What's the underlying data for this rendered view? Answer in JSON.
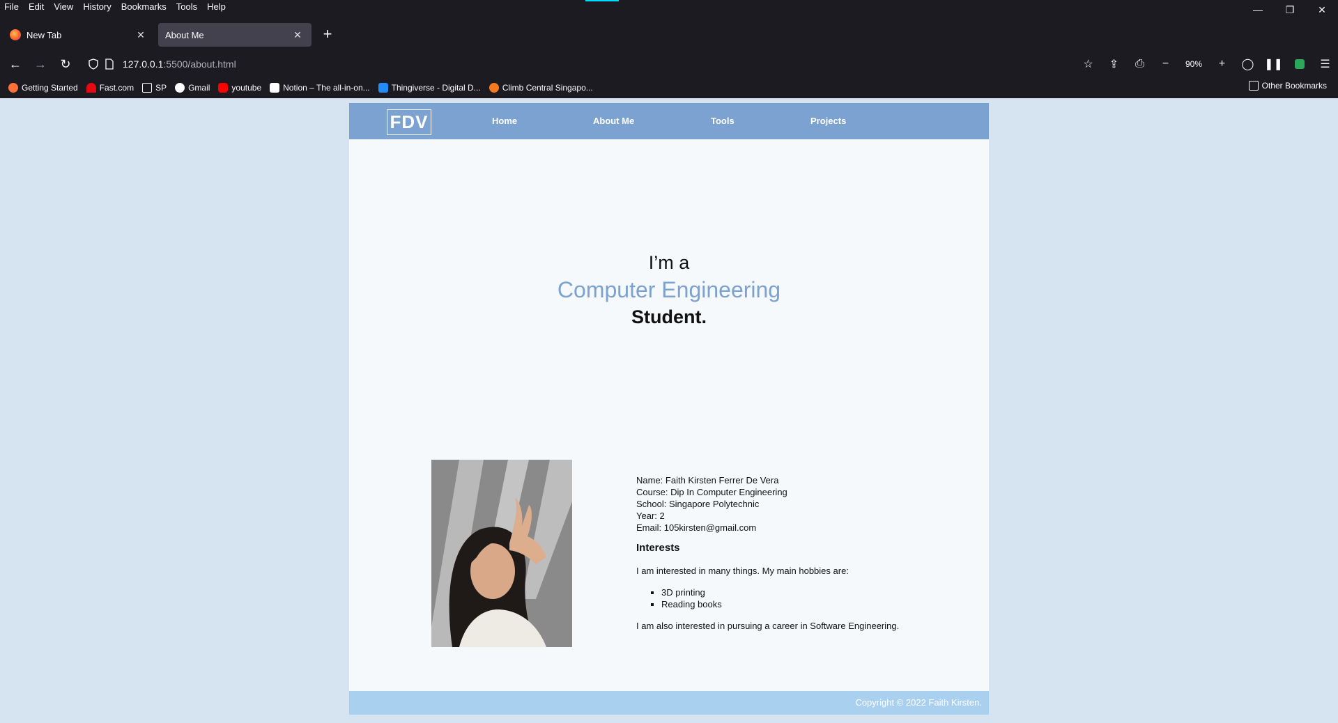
{
  "menubar": [
    "File",
    "Edit",
    "View",
    "History",
    "Bookmarks",
    "Tools",
    "Help"
  ],
  "tabs": [
    {
      "title": "New Tab",
      "active": false
    },
    {
      "title": "About Me",
      "active": true
    }
  ],
  "address": {
    "host": "127.0.0.1",
    "path": ":5500/about.html"
  },
  "zoom": "90%",
  "bookmarks": [
    {
      "label": "Getting Started",
      "color": "#ff7139"
    },
    {
      "label": "Fast.com",
      "color": "#e50914"
    },
    {
      "label": "SP",
      "color": "#fbfbfe"
    },
    {
      "label": "Gmail",
      "color": "#4285f4"
    },
    {
      "label": "youtube",
      "color": "#ff0000"
    },
    {
      "label": "Notion – The all-in-on...",
      "color": "#ffffff"
    },
    {
      "label": "Thingiverse - Digital D...",
      "color": "#248bfb"
    },
    {
      "label": "Climb Central Singapo...",
      "color": "#f47a20"
    }
  ],
  "other_bookmarks": "Other Bookmarks",
  "site": {
    "logo": "FDV",
    "nav": [
      "Home",
      "About Me",
      "Tools",
      "Projects"
    ],
    "hero": {
      "line1": "I’m a",
      "accent": "Computer Engineering",
      "line3": "Student."
    },
    "info": {
      "name": "Name: Faith Kirsten Ferrer De Vera",
      "course": "Course: Dip In Computer Engineering",
      "school": "School: Singapore Polytechnic",
      "year": "Year: 2",
      "email": "Email: 105kirsten@gmail.com"
    },
    "interests_heading": "Interests",
    "interests_intro": "I am interested in many things. My main hobbies are:",
    "hobbies": [
      "3D printing",
      "Reading books"
    ],
    "career": "I am also interested in pursuing a career in Software Engineering.",
    "footer": "Copyright © 2022 Faith Kirsten."
  },
  "colors": {
    "nav": "#7ba2d0",
    "accent": "#7ba2d0",
    "footer": "#a9d0ef",
    "page_bg": "#d6e4f1",
    "chrome": "#1c1b22"
  }
}
